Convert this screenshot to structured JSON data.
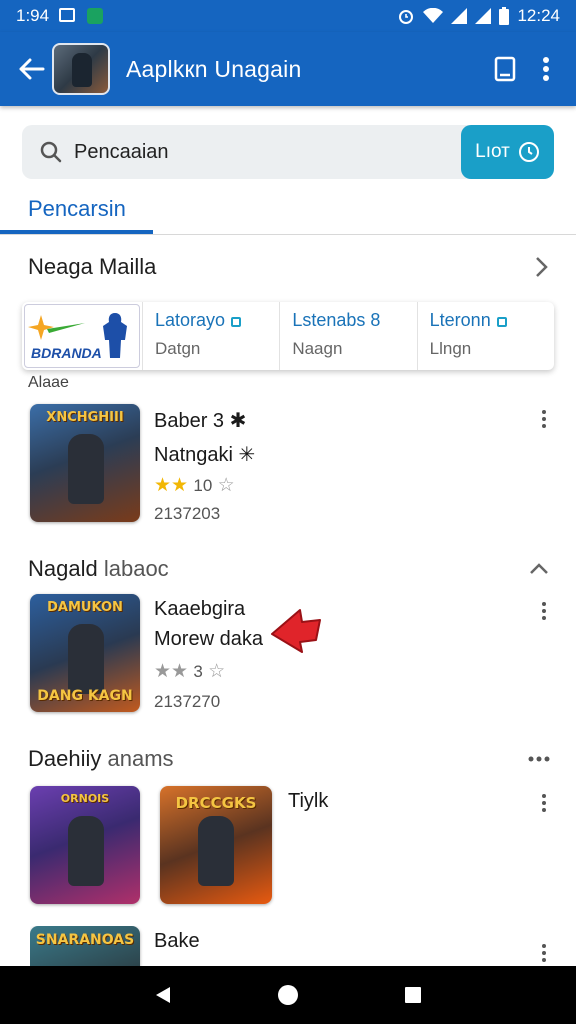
{
  "status_bar": {
    "time_left": "1:94",
    "time_right": "12:24"
  },
  "app_bar": {
    "title": "Aaplkкn Unagain",
    "icons": [
      "back-arrow-icon",
      "bookmark-icon",
      "more-vert-icon"
    ]
  },
  "search": {
    "value": "Pencaaian",
    "button_label": "Lıот"
  },
  "tab": {
    "label": "Pencarsin"
  },
  "section1": {
    "title": "Neaga Mailla",
    "featured_logo_text": "BDRANDA",
    "items": [
      {
        "name": "Latorayo",
        "sub": "Datgn"
      },
      {
        "name": "Lstenabs 8",
        "sub": "Naagn"
      },
      {
        "name": "Lteronn",
        "sub": "Llngn"
      }
    ],
    "small_label": "Alaae"
  },
  "app1": {
    "thumb_caption": "XNCHGHIII",
    "line1": "Baber 3 ✱",
    "line2": "Natngaki ✳",
    "rating_text": "10",
    "downloads": "2137203"
  },
  "section2": {
    "title": "Nagald",
    "title_sub": "labaoc"
  },
  "app2": {
    "thumb_caption_top": "DAMUKON",
    "thumb_caption_bottom": "DANG KAGN",
    "line1": "Kaaebgira",
    "line2": "Morew daka",
    "rating_text": "3",
    "downloads": "2137270"
  },
  "section3": {
    "title": "Daehiiy",
    "title_sub": "anams"
  },
  "app3": {
    "caption_a": "ORNOIS",
    "caption_b": "DRCCGKS",
    "label": "Tiylk"
  },
  "app4": {
    "caption": "SNARANOAS",
    "label": "Bake"
  },
  "colors": {
    "primary": "#1565c0",
    "accent": "#1a9fc8",
    "star": "#f2b705"
  }
}
